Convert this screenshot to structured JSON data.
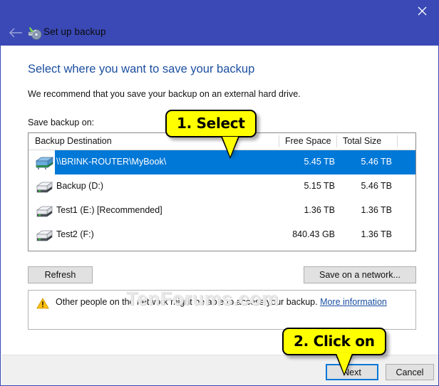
{
  "window": {
    "title": "Set up backup",
    "title_icon": "backup-disc-icon",
    "back_icon": "back-arrow-icon",
    "close_icon": "close-icon",
    "accent_color": "#3a49b5",
    "selection_color": "#0078d7"
  },
  "body": {
    "heading": "Select where you want to save your backup",
    "subheading": "We recommend that you save your backup on an external hard drive.",
    "save_label": "Save backup on:"
  },
  "list": {
    "columns": [
      "Backup Destination",
      "Free Space",
      "Total Size"
    ],
    "rows": [
      {
        "icon": "network-drive-icon",
        "name": "\\\\BRINK-ROUTER\\MyBook\\",
        "free_space": "5.45 TB",
        "total_size": "5.46 TB",
        "selected": true
      },
      {
        "icon": "hard-drive-icon",
        "name": "Backup (D:)",
        "free_space": "5.15 TB",
        "total_size": "5.46 TB",
        "selected": false
      },
      {
        "icon": "hard-drive-icon",
        "name": "Test1 (E:) [Recommended]",
        "free_space": "1.36 TB",
        "total_size": "1.36 TB",
        "selected": false
      },
      {
        "icon": "hard-drive-icon",
        "name": "Test2 (F:)",
        "free_space": "840.43 GB",
        "total_size": "1.36 TB",
        "selected": false
      }
    ]
  },
  "watermark": "TenForums.com",
  "buttons": {
    "refresh": "Refresh",
    "save_on_network": "Save on a network...",
    "next": "Next",
    "cancel": "Cancel"
  },
  "warning": {
    "icon": "warning-triangle-icon",
    "text": "Other people on the network might be able to access your backup.",
    "link": "More information"
  },
  "callouts": [
    {
      "label": "1. Select"
    },
    {
      "label": "2. Click on"
    }
  ]
}
